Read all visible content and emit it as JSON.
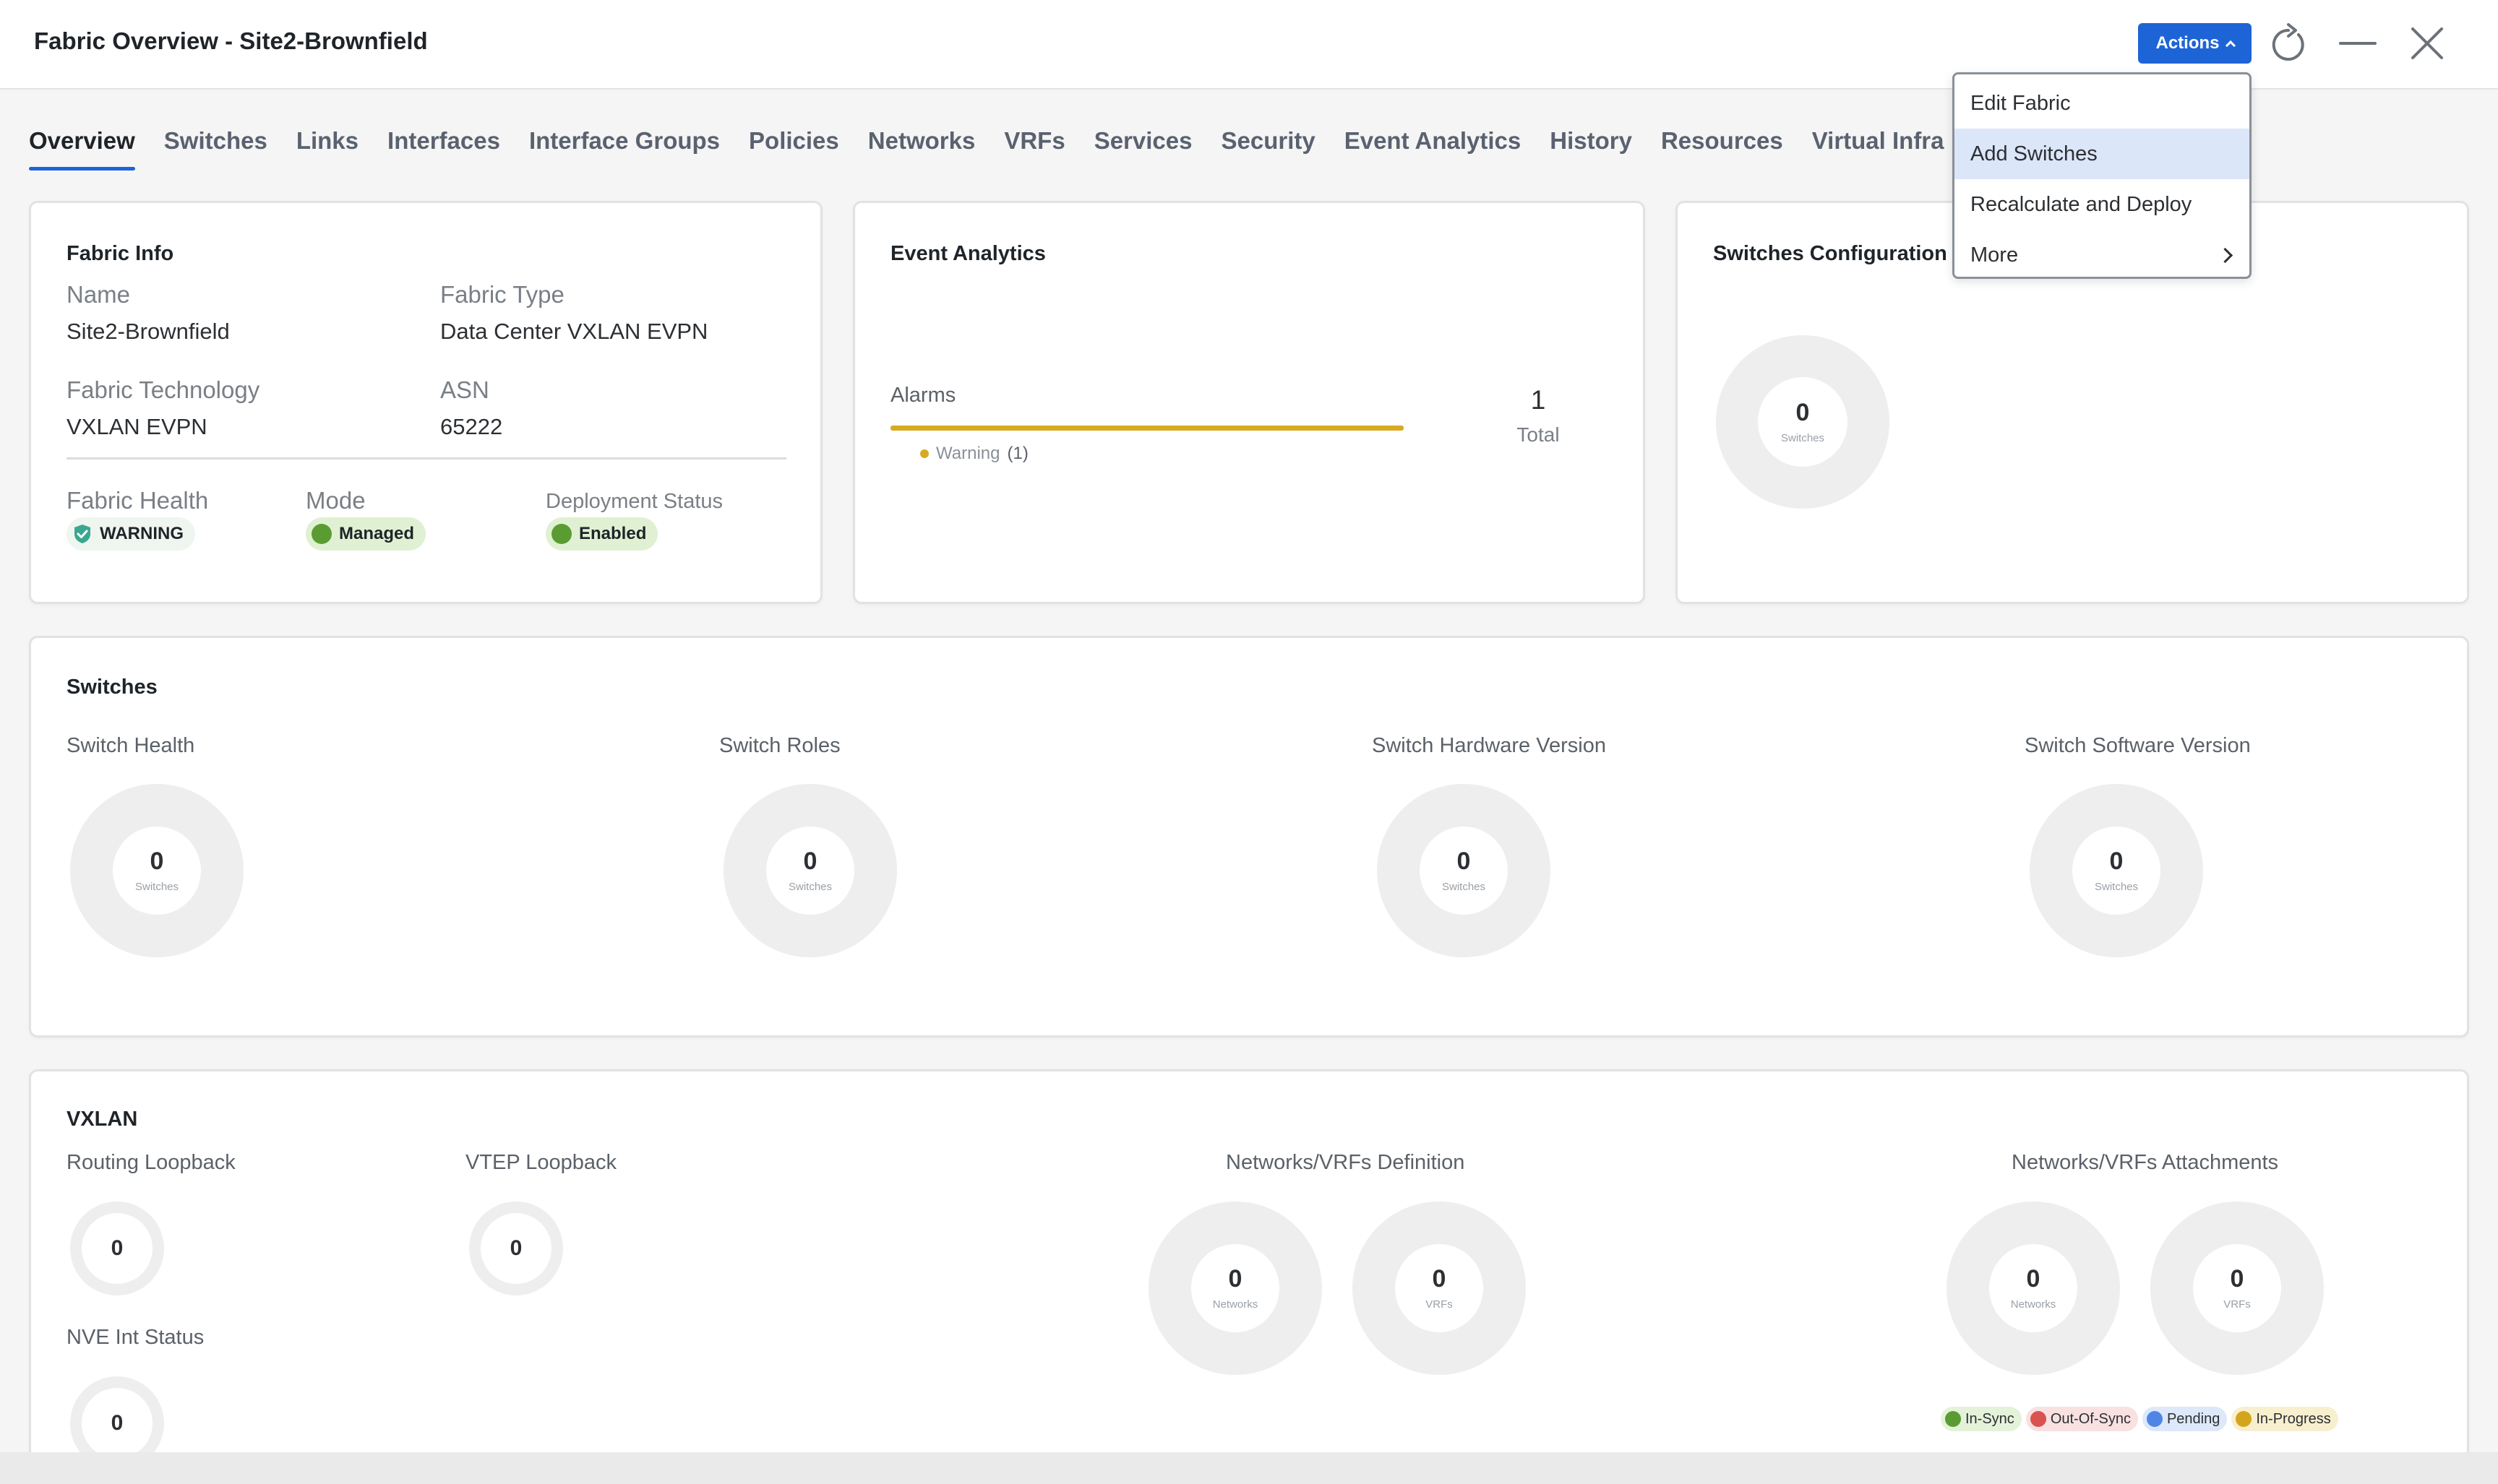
{
  "header": {
    "title": "Fabric Overview - Site2-Brownfield",
    "actions_label": "Actions"
  },
  "tabs": [
    {
      "label": "Overview",
      "active": true
    },
    {
      "label": "Switches"
    },
    {
      "label": "Links"
    },
    {
      "label": "Interfaces"
    },
    {
      "label": "Interface Groups"
    },
    {
      "label": "Policies"
    },
    {
      "label": "Networks"
    },
    {
      "label": "VRFs"
    },
    {
      "label": "Services"
    },
    {
      "label": "Security"
    },
    {
      "label": "Event Analytics"
    },
    {
      "label": "History"
    },
    {
      "label": "Resources"
    },
    {
      "label": "Virtual Infra"
    }
  ],
  "actions_menu": {
    "items": [
      {
        "label": "Edit Fabric"
      },
      {
        "label": "Add Switches",
        "selected": true
      },
      {
        "label": "Recalculate and Deploy"
      },
      {
        "label": "More",
        "has_submenu": true
      }
    ]
  },
  "fabric_info": {
    "title": "Fabric Info",
    "name_label": "Name",
    "name_value": "Site2-Brownfield",
    "type_label": "Fabric Type",
    "type_value": "Data Center VXLAN EVPN",
    "tech_label": "Fabric Technology",
    "tech_value": "VXLAN EVPN",
    "asn_label": "ASN",
    "asn_value": "65222",
    "health_label": "Fabric Health",
    "health_value": "WARNING",
    "mode_label": "Mode",
    "mode_value": "Managed",
    "deploy_label": "Deployment Status",
    "deploy_value": "Enabled"
  },
  "event_analytics": {
    "title": "Event Analytics",
    "alarms_label": "Alarms",
    "warning_label": "Warning",
    "warning_count": "(1)",
    "total_value": "1",
    "total_label": "Total"
  },
  "switches_config": {
    "title": "Switches Configuration",
    "count": "0",
    "unit": "Switches"
  },
  "switches": {
    "title": "Switches",
    "charts": [
      {
        "label": "Switch Health",
        "count": "0",
        "unit": "Switches"
      },
      {
        "label": "Switch Roles",
        "count": "0",
        "unit": "Switches"
      },
      {
        "label": "Switch Hardware Version",
        "count": "0",
        "unit": "Switches"
      },
      {
        "label": "Switch Software Version",
        "count": "0",
        "unit": "Switches"
      }
    ]
  },
  "vxlan": {
    "title": "VXLAN",
    "routing_loopback_label": "Routing Loopback",
    "routing_loopback_count": "0",
    "vtep_loopback_label": "VTEP Loopback",
    "vtep_loopback_count": "0",
    "nve_label": "NVE Int Status",
    "nve_count": "0",
    "definition_label": "Networks/VRFs Definition",
    "attachments_label": "Networks/VRFs Attachments",
    "def_networks_count": "0",
    "def_networks_unit": "Networks",
    "def_vrfs_count": "0",
    "def_vrfs_unit": "VRFs",
    "att_networks_count": "0",
    "att_networks_unit": "Networks",
    "att_vrfs_count": "0",
    "att_vrfs_unit": "VRFs",
    "legend": [
      {
        "label": "In-Sync",
        "color": "#5a9c31",
        "bg": "#e4f2da"
      },
      {
        "label": "Out-Of-Sync",
        "color": "#d9534f",
        "bg": "#f8e1e0"
      },
      {
        "label": "Pending",
        "color": "#4f86e6",
        "bg": "#dde8fa"
      },
      {
        "label": "In-Progress",
        "color": "#d4a51c",
        "bg": "#f8efcf"
      }
    ]
  },
  "colors": {
    "accent": "#1d64d6",
    "warning_bar": "#d8a923",
    "healthy": "#5a9c31"
  }
}
